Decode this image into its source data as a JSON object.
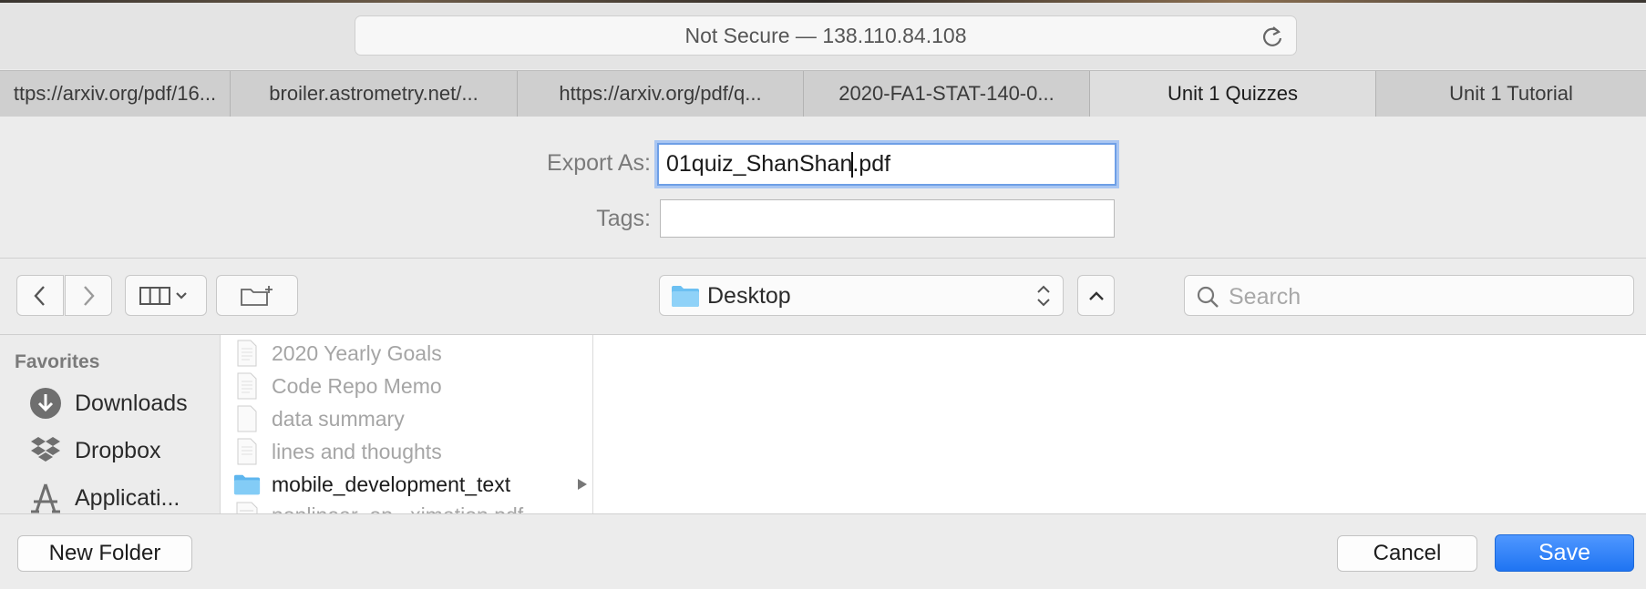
{
  "address_bar": {
    "text": "Not Secure — 138.110.84.108"
  },
  "tabs": [
    {
      "label": "ttps://arxiv.org/pdf/16..."
    },
    {
      "label": "broiler.astrometry.net/..."
    },
    {
      "label": "https://arxiv.org/pdf/q..."
    },
    {
      "label": "2020-FA1-STAT-140-0..."
    },
    {
      "label": "Unit 1 Quizzes"
    },
    {
      "label": "Unit 1 Tutorial"
    }
  ],
  "export": {
    "export_as_label": "Export As:",
    "filename_before_caret": "01quiz_ShanShan",
    "filename_after_caret": ".pdf",
    "tags_label": "Tags:",
    "tags_value": ""
  },
  "location": {
    "current": "Desktop"
  },
  "search": {
    "placeholder": "Search"
  },
  "sidebar": {
    "heading": "Favorites",
    "items": [
      {
        "label": "Downloads",
        "icon": "download-icon"
      },
      {
        "label": "Dropbox",
        "icon": "dropbox-icon"
      },
      {
        "label": "Applicati...",
        "icon": "applications-icon"
      }
    ]
  },
  "files": [
    {
      "name": "2020 Yearly Goals",
      "type": "document"
    },
    {
      "name": "Code Repo Memo",
      "type": "document"
    },
    {
      "name": "data summary",
      "type": "document"
    },
    {
      "name": "lines and thoughts",
      "type": "document"
    },
    {
      "name": "mobile_development_text",
      "type": "folder"
    },
    {
      "name": "nonlinear_op...ximation.pdf",
      "type": "pdf"
    }
  ],
  "buttons": {
    "new_folder": "New Folder",
    "cancel": "Cancel",
    "save": "Save"
  },
  "colors": {
    "accent": "#2a7df5",
    "folder": "#6cc0f2",
    "focus_ring": "#6e9fe6"
  }
}
